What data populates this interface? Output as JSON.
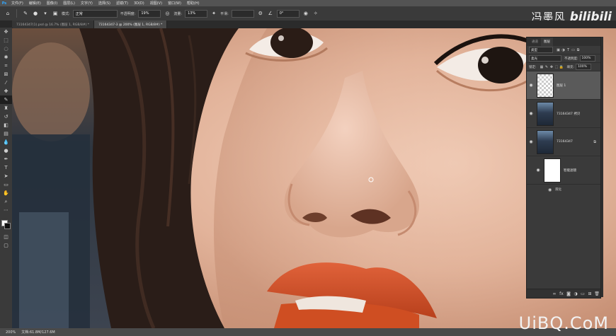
{
  "menu": {
    "logo": "Ps",
    "items": [
      "文件(F)",
      "编辑(E)",
      "图像(I)",
      "图层(L)",
      "文字(Y)",
      "选择(S)",
      "滤镜(T)",
      "3D(D)",
      "视图(V)",
      "窗口(W)",
      "帮助(H)"
    ]
  },
  "options": {
    "mode_label": "模式:",
    "mode_value": "正常",
    "opacity_label": "不透明度:",
    "opacity_value": "19%",
    "flow_label": "流量:",
    "flow_value": "13%",
    "smooth_label": "平滑:",
    "angle_value": "0°"
  },
  "watermark": {
    "cn": "冯墨风",
    "bili": "bilibili"
  },
  "tabs": [
    {
      "label": "73164347(1).psd @ 16.7% (图层 1, RGB/8#) *"
    },
    {
      "label": "73164347-3 @ 200% (图层 1, RGB/8#) *"
    }
  ],
  "status": {
    "zoom": "200%",
    "doc": "文档:61.8M/127.6M"
  },
  "corner_watermark": "UiBQ.CoM",
  "panel": {
    "tabs": [
      "通道",
      "图层"
    ],
    "kind_label": "类型",
    "blend_mode": "柔光",
    "opacity_label": "不透明度:",
    "opacity_value": "100%",
    "lock_label": "锁定:",
    "fill_label": "填充:",
    "fill_value": "100%",
    "layers": [
      {
        "name": "图层 1",
        "selected": true
      },
      {
        "name": "73164347 拷贝",
        "selected": false
      },
      {
        "name": "73164347",
        "selected": false
      },
      {
        "name": "智能滤镜",
        "selected": false
      }
    ],
    "filter_name": "液化"
  },
  "colors": {
    "accent": "#31a8ff",
    "lip": "#d9522a",
    "skin": "#e7bea5"
  }
}
